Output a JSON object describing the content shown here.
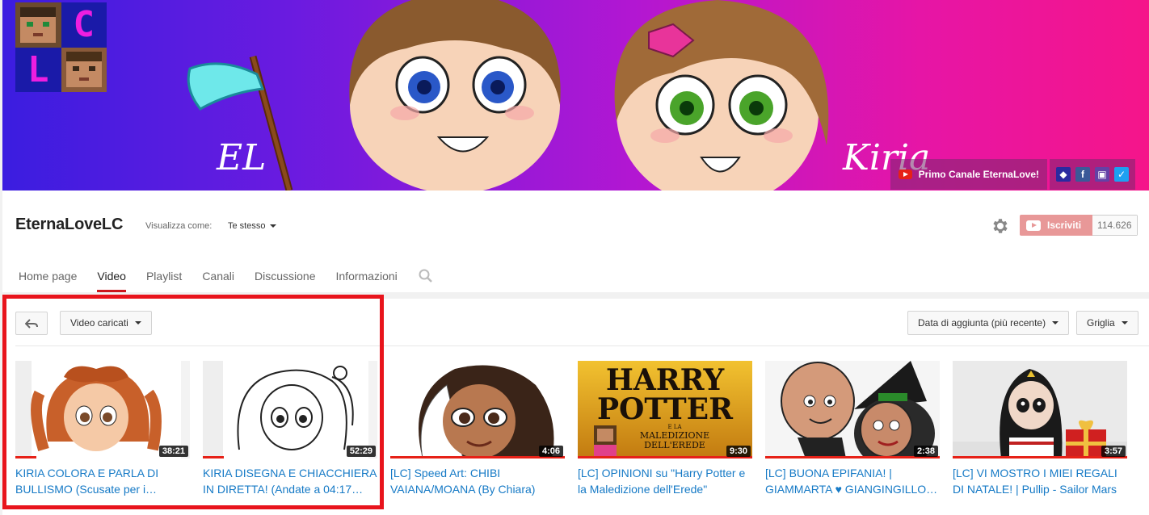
{
  "banner": {
    "primary_link_label": "Primo Canale EternaLove!",
    "avatar_letters": [
      "C",
      "L"
    ],
    "art_text_left": "EL",
    "art_text_right": "Kiria",
    "social_icons": [
      "avatar-icon",
      "facebook-icon",
      "twitch-icon",
      "twitter-icon"
    ]
  },
  "header": {
    "channel_name": "EternaLoveLC",
    "view_as_label": "Visualizza come:",
    "view_as_value": "Te stesso",
    "subscribe_label": "Iscriviti",
    "subscriber_count": "114.626"
  },
  "tabs": [
    {
      "label": "Home page",
      "active": false
    },
    {
      "label": "Video",
      "active": true
    },
    {
      "label": "Playlist",
      "active": false
    },
    {
      "label": "Canali",
      "active": false
    },
    {
      "label": "Discussione",
      "active": false
    },
    {
      "label": "Informazioni",
      "active": false
    }
  ],
  "toolbar": {
    "uploads_label": "Video caricati",
    "sort_label": "Data di aggiunta (più recente)",
    "view_label": "Griglia"
  },
  "videos": [
    {
      "title": "KIRIA COLORA E PARLA DI BULLISMO (Scusate per i…",
      "duration": "38:21",
      "watched": "partial"
    },
    {
      "title": "KIRIA DISEGNA E CHIACCHIERA IN DIRETTA! (Andate a 04:17…",
      "duration": "52:29",
      "watched": "partial"
    },
    {
      "title": "[LC] Speed Art: CHIBI VAIANA/MOANA (By Chiara)",
      "duration": "4:06",
      "watched": "full"
    },
    {
      "title": "[LC] OPINIONI su \"Harry Potter e la Maledizione dell'Erede\"",
      "duration": "9:30",
      "watched": "full",
      "thumb_text": [
        "HARRY",
        "POTTER",
        "E LA",
        "MALEDIZIONE",
        "DELL'EREDE"
      ]
    },
    {
      "title": "[LC] BUONA EPIFANIA! | GIAMMARTA ♥ GIANGINGILLO…",
      "duration": "2:38",
      "watched": "full"
    },
    {
      "title": "[LC] VI MOSTRO I MIEI REGALI DI NATALE! | Pullip - Sailor Mars",
      "duration": "3:57",
      "watched": "full"
    }
  ],
  "colors": {
    "accent_red": "#e62117",
    "link_blue": "#167ac6",
    "highlight_red": "#e8141c",
    "subscribe_bg": "#e89898"
  }
}
